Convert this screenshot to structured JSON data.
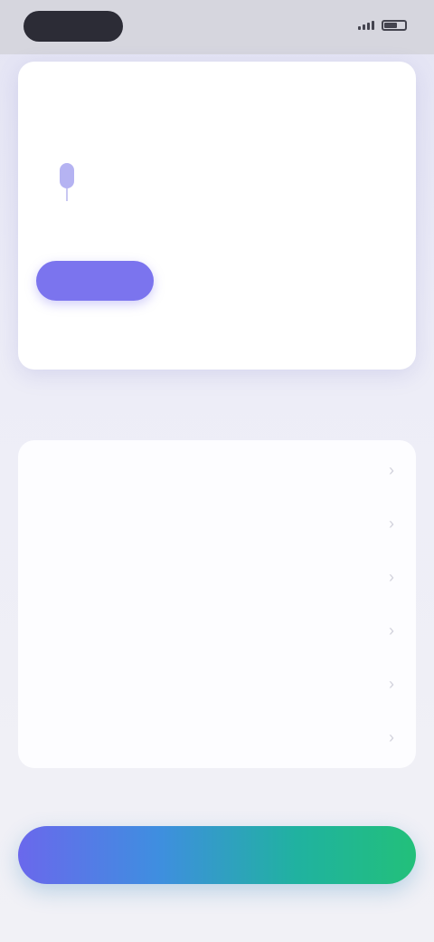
{
  "status_bar": {
    "time": "",
    "icons": [
      "signal-icon",
      "battery-icon"
    ]
  },
  "setup_card": {
    "action_link": "",
    "section_label": "",
    "section_label_right": "",
    "voice": {
      "icon": "mic-icon",
      "name": "",
      "meta": ""
    },
    "modes": [
      {
        "label": "",
        "active": true
      },
      {
        "label": "",
        "active": false
      },
      {
        "label": "",
        "active": false
      }
    ],
    "hint": ""
  },
  "settings": {
    "title": "",
    "rows": [
      {
        "label": ""
      },
      {
        "label": ""
      },
      {
        "label": ""
      },
      {
        "label": ""
      },
      {
        "label": ""
      },
      {
        "label": ""
      }
    ]
  },
  "primary_action": {
    "label": ""
  },
  "colors": {
    "accent": "#7b74ee",
    "gradient_start": "#6a68ec",
    "gradient_end": "#22c07a",
    "background": "#ededf7",
    "card": "#ffffff"
  }
}
